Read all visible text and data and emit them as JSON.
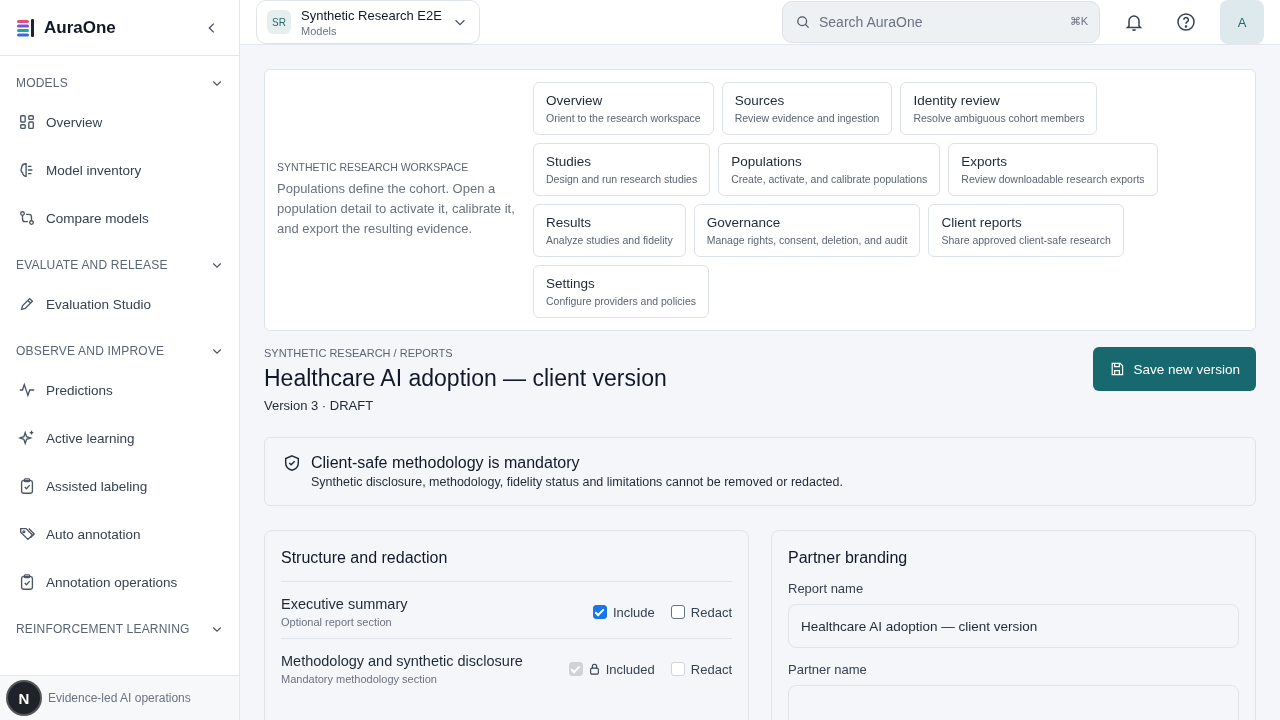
{
  "brand": {
    "name": "AuraOne"
  },
  "sidebar": {
    "sections": [
      {
        "title": "MODELS",
        "expanded": true,
        "items": [
          {
            "label": "Overview"
          },
          {
            "label": "Model inventory"
          },
          {
            "label": "Compare models"
          }
        ]
      },
      {
        "title": "EVALUATE AND RELEASE",
        "expanded": true,
        "items": [
          {
            "label": "Evaluation Studio"
          }
        ]
      },
      {
        "title": "OBSERVE AND IMPROVE",
        "expanded": true,
        "items": [
          {
            "label": "Predictions"
          },
          {
            "label": "Active learning"
          },
          {
            "label": "Assisted labeling"
          },
          {
            "label": "Auto annotation"
          },
          {
            "label": "Annotation operations"
          }
        ]
      },
      {
        "title": "REINFORCEMENT LEARNING",
        "expanded": true
      }
    ],
    "footer": "Evidence-led AI operations",
    "badge": "N"
  },
  "workspace_switcher": {
    "initials": "SR",
    "name": "Synthetic Research E2E",
    "subtitle": "Models"
  },
  "search": {
    "placeholder": "Search AuraOne",
    "shortcut": "⌘K"
  },
  "avatar": "A",
  "workspace_card": {
    "eyebrow": "SYNTHETIC RESEARCH WORKSPACE",
    "description": "Populations define the cohort. Open a population detail to activate it, calibrate it, and export the resulting evidence.",
    "links": [
      {
        "title": "Overview",
        "subtitle": "Orient to the research workspace"
      },
      {
        "title": "Sources",
        "subtitle": "Review evidence and ingestion"
      },
      {
        "title": "Identity review",
        "subtitle": "Resolve ambiguous cohort members"
      },
      {
        "title": "Studies",
        "subtitle": "Design and run research studies"
      },
      {
        "title": "Populations",
        "subtitle": "Create, activate, and calibrate populations"
      },
      {
        "title": "Exports",
        "subtitle": "Review downloadable research exports"
      },
      {
        "title": "Results",
        "subtitle": "Analyze studies and fidelity"
      },
      {
        "title": "Governance",
        "subtitle": "Manage rights, consent, deletion, and audit"
      },
      {
        "title": "Client reports",
        "subtitle": "Share approved client-safe research"
      },
      {
        "title": "Settings",
        "subtitle": "Configure providers and policies"
      }
    ]
  },
  "page": {
    "breadcrumb": "SYNTHETIC RESEARCH / REPORTS",
    "title": "Healthcare AI adoption — client version",
    "meta": "Version 3 · DRAFT",
    "primary_button": "Save new version"
  },
  "notice": {
    "title": "Client-safe methodology is mandatory",
    "text": "Synthetic disclosure, methodology, fidelity status and limitations cannot be removed or redacted."
  },
  "structure": {
    "title": "Structure and redaction",
    "sections": [
      {
        "name": "Executive summary",
        "note": "Optional report section",
        "include_label": "Include",
        "include_checked": true,
        "locked": false,
        "redact_label": "Redact",
        "redact_checked": false
      },
      {
        "name": "Methodology and synthetic disclosure",
        "note": "Mandatory methodology section",
        "include_label": "Included",
        "include_checked": true,
        "locked": true,
        "redact_label": "Redact",
        "redact_checked": false
      }
    ]
  },
  "branding": {
    "title": "Partner branding",
    "fields": [
      {
        "label": "Report name",
        "value": "Healthcare AI adoption — client version"
      },
      {
        "label": "Partner name"
      }
    ]
  }
}
